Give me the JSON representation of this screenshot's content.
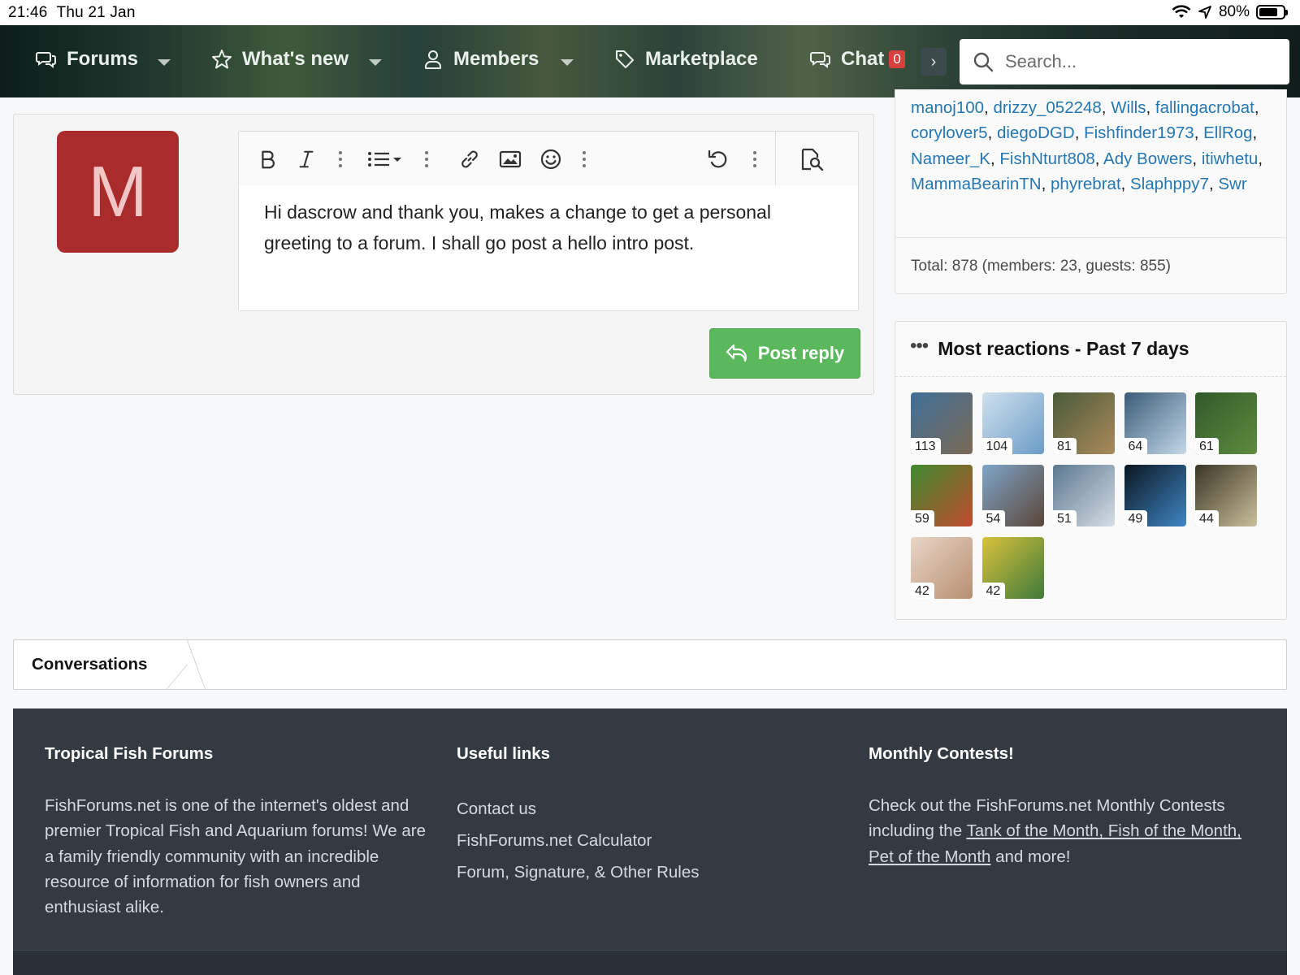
{
  "status_bar": {
    "time": "21:46",
    "date": "Thu 21 Jan",
    "battery": "80%",
    "battery_level": 0.8
  },
  "nav": {
    "items": [
      {
        "label": "Forums",
        "icon": "chat-bubbles-icon"
      },
      {
        "label": "What's new",
        "icon": "star-icon"
      },
      {
        "label": "Members",
        "icon": "user-icon"
      },
      {
        "label": "Marketplace",
        "icon": "tag-icon"
      },
      {
        "label": "Chat",
        "icon": "chat-bubbles-icon",
        "badge": "0"
      }
    ],
    "more": "›",
    "search_placeholder": "Search..."
  },
  "reply": {
    "avatar_letter": "M",
    "avatar_color": "#a92b2b",
    "editor_text": "Hi dascrow and thank you, makes a change to get a personal greeting to a forum. I shall go post a hello intro post.",
    "post_button": "Post reply",
    "button_color": "#5cb85c"
  },
  "online": {
    "names": [
      "manoj100",
      "drizzy_052248",
      "Wills",
      "fallingacrobat",
      "corylover5",
      "diegoDGD",
      "Fishfinder1973",
      "EllRog",
      "Nameer_K",
      "FishNturt808",
      "Ady Bowers",
      "itiwhetu",
      "MammaBearinTN",
      "phyrebrat",
      "Slaphppy7",
      "Swr"
    ],
    "total": "Total: 878 (members: 23, guests: 855)"
  },
  "reactions": {
    "title": "Most reactions - Past 7 days",
    "tiles": [
      {
        "count": "113",
        "color_a": "#3f6f9a",
        "color_b": "#7a6a55"
      },
      {
        "count": "104",
        "color_a": "#cfe0ee",
        "color_b": "#6b9cc6"
      },
      {
        "count": "81",
        "color_a": "#4a5a3a",
        "color_b": "#a98a5a"
      },
      {
        "count": "64",
        "color_a": "#3a5b78",
        "color_b": "#c4d8e8"
      },
      {
        "count": "61",
        "color_a": "#2f5a2a",
        "color_b": "#5f8a3e"
      },
      {
        "count": "59",
        "color_a": "#3e8a2e",
        "color_b": "#c24a2e"
      },
      {
        "count": "54",
        "color_a": "#7fa5c8",
        "color_b": "#5a4638"
      },
      {
        "count": "51",
        "color_a": "#5b7890",
        "color_b": "#d6dde4"
      },
      {
        "count": "49",
        "color_a": "#0b1620",
        "color_b": "#3f86c4"
      },
      {
        "count": "44",
        "color_a": "#3a3526",
        "color_b": "#c9c09a"
      },
      {
        "count": "42",
        "color_a": "#e8d5c8",
        "color_b": "#b89070"
      },
      {
        "count": "42",
        "color_a": "#d8c23a",
        "color_b": "#3f7a3a"
      }
    ]
  },
  "conversations": {
    "label": "Conversations"
  },
  "footer": {
    "col1": {
      "title": "Tropical Fish Forums",
      "text": "FishForums.net is one of the internet's oldest and premier Tropical Fish and Aquarium forums! We are a family friendly community with an incredible resource of information for fish owners and enthusiast alike."
    },
    "col2": {
      "title": "Useful links",
      "links": [
        "Contact us",
        "FishForums.net Calculator",
        "Forum, Signature, & Other Rules"
      ]
    },
    "col3": {
      "title": "Monthly Contests!",
      "text_before": "Check out the FishForums.net Monthly Contests including the ",
      "link": "Tank of the Month, Fish of the Month, Pet of the Month",
      "text_after": " and more!"
    }
  }
}
